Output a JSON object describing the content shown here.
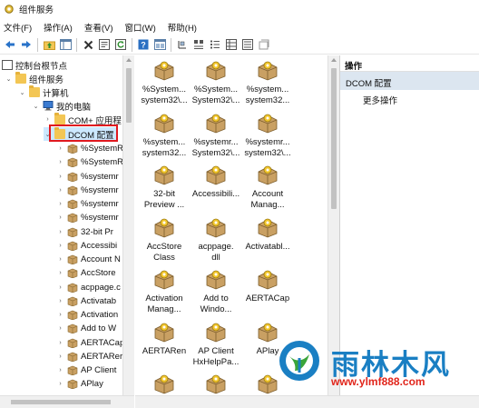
{
  "window": {
    "title": "组件服务"
  },
  "menu": [
    "文件(F)",
    "操作(A)",
    "查看(V)",
    "窗口(W)",
    "帮助(H)"
  ],
  "toolbar": [
    "back-arrow-icon",
    "forward-arrow-icon",
    "up-folder-icon",
    "show-tree-icon",
    "delete-icon",
    "properties-icon",
    "refresh-icon",
    "help-icon",
    "mmc-icon",
    "detail-view-icon",
    "large-icons-view-icon",
    "small-icons-view-icon",
    "list-view-icon",
    "list-detail-view-icon",
    "new-item-icon"
  ],
  "tree": [
    {
      "label": "控制台根节点",
      "level": 0,
      "expanded": true
    },
    {
      "label": "组件服务",
      "level": 1,
      "expanded": true
    },
    {
      "label": "计算机",
      "level": 2,
      "expanded": true
    },
    {
      "label": "我的电脑",
      "level": 3,
      "expanded": true
    },
    {
      "label": "COM+ 应用程",
      "level": 4,
      "expanded": false
    },
    {
      "label": "DCOM 配置",
      "level": 4,
      "expanded": true,
      "selected": true
    },
    {
      "label": "%SystemR",
      "level": 5
    },
    {
      "label": "%SystemR",
      "level": 5
    },
    {
      "label": "%systemr",
      "level": 5
    },
    {
      "label": "%systemr",
      "level": 5
    },
    {
      "label": "%systemr",
      "level": 5
    },
    {
      "label": "%systemr",
      "level": 5
    },
    {
      "label": "32-bit Pr",
      "level": 5
    },
    {
      "label": "Accessibi",
      "level": 5
    },
    {
      "label": "Account N",
      "level": 5
    },
    {
      "label": "AccStore",
      "level": 5
    },
    {
      "label": "acppage.c",
      "level": 5
    },
    {
      "label": "Activatab",
      "level": 5
    },
    {
      "label": "Activation",
      "level": 5
    },
    {
      "label": "Add to W",
      "level": 5
    },
    {
      "label": "AERTACap",
      "level": 5
    },
    {
      "label": "AERTARer",
      "level": 5
    },
    {
      "label": "AP Client",
      "level": 5
    },
    {
      "label": "APlay",
      "level": 5
    }
  ],
  "list_items": [
    [
      "%System...",
      "system32\\..."
    ],
    [
      "%System...",
      "System32\\..."
    ],
    [
      "%system...",
      "system32..."
    ],
    [
      "%system...",
      "system32..."
    ],
    [
      "%systemr...",
      "System32\\..."
    ],
    [
      "%systemr...",
      "system32\\..."
    ],
    [
      "32-bit",
      "Preview ..."
    ],
    [
      "Accessibili...",
      ""
    ],
    [
      "Account",
      "Manag..."
    ],
    [
      "AccStore",
      "Class"
    ],
    [
      "acppage.",
      "dll"
    ],
    [
      "Activatabl...",
      ""
    ],
    [
      "Activation",
      "Manag..."
    ],
    [
      "Add to",
      "Windo..."
    ],
    [
      "AERTACap",
      ""
    ],
    [
      "AERTARen",
      ""
    ],
    [
      "AP Client",
      "HxHelpPa..."
    ],
    [
      "APlay",
      ""
    ],
    [
      "",
      ""
    ],
    [
      "",
      ""
    ],
    [
      "",
      ""
    ]
  ],
  "actions": {
    "header": "操作",
    "group": "DCOM 配置",
    "more": "更多操作"
  },
  "watermark": {
    "title": "雨林木风",
    "url": "www.ylmf888.com"
  },
  "colors": {
    "selection_box": "#e0191f",
    "action_group_bg": "#dce6f0",
    "watermark_blue": "#1a7fc3",
    "watermark_red": "#e1251b"
  }
}
